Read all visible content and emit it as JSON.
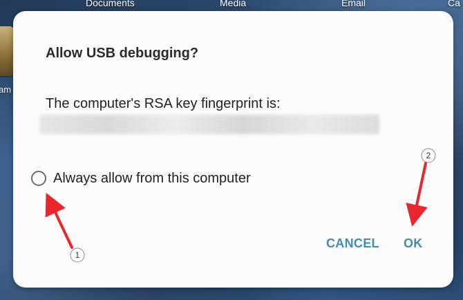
{
  "homescreen": {
    "top_labels": [
      "Documents",
      "Media",
      "Email",
      "Ca"
    ],
    "left_app_label": "am"
  },
  "dialog": {
    "title": "Allow USB debugging?",
    "message": "The computer's RSA key fingerprint is:",
    "checkbox_label": "Always allow from this computer",
    "checkbox_checked": false,
    "cancel_label": "CANCEL",
    "ok_label": "OK"
  },
  "annotations": {
    "badge_1": "1",
    "badge_2": "2",
    "arrow_color": "#e8262b"
  },
  "colors": {
    "dialog_bg": "#fbfbfb",
    "button_text": "#3f8fa8",
    "title_text": "#2b2b2b"
  }
}
